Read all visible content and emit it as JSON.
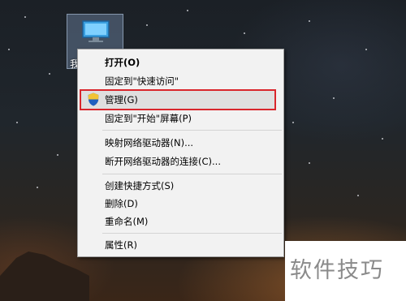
{
  "desktop": {
    "icon_caption": "我",
    "icon_name": "computer-icon"
  },
  "context_menu": {
    "items": [
      {
        "label": "打开(O)",
        "bold": true
      },
      {
        "label": "固定到\"快速访问\""
      },
      {
        "label": "管理(G)",
        "icon": "uac-shield-icon",
        "highlighted": true
      },
      {
        "label": "固定到\"开始\"屏幕(P)"
      },
      {
        "label": "映射网络驱动器(N)..."
      },
      {
        "label": "断开网络驱动器的连接(C)..."
      },
      {
        "label": "创建快捷方式(S)"
      },
      {
        "label": "删除(D)"
      },
      {
        "label": "重命名(M)"
      },
      {
        "label": "属性(R)"
      }
    ],
    "highlight_color": "#d9262c"
  },
  "watermark": {
    "text": "软件技巧"
  }
}
